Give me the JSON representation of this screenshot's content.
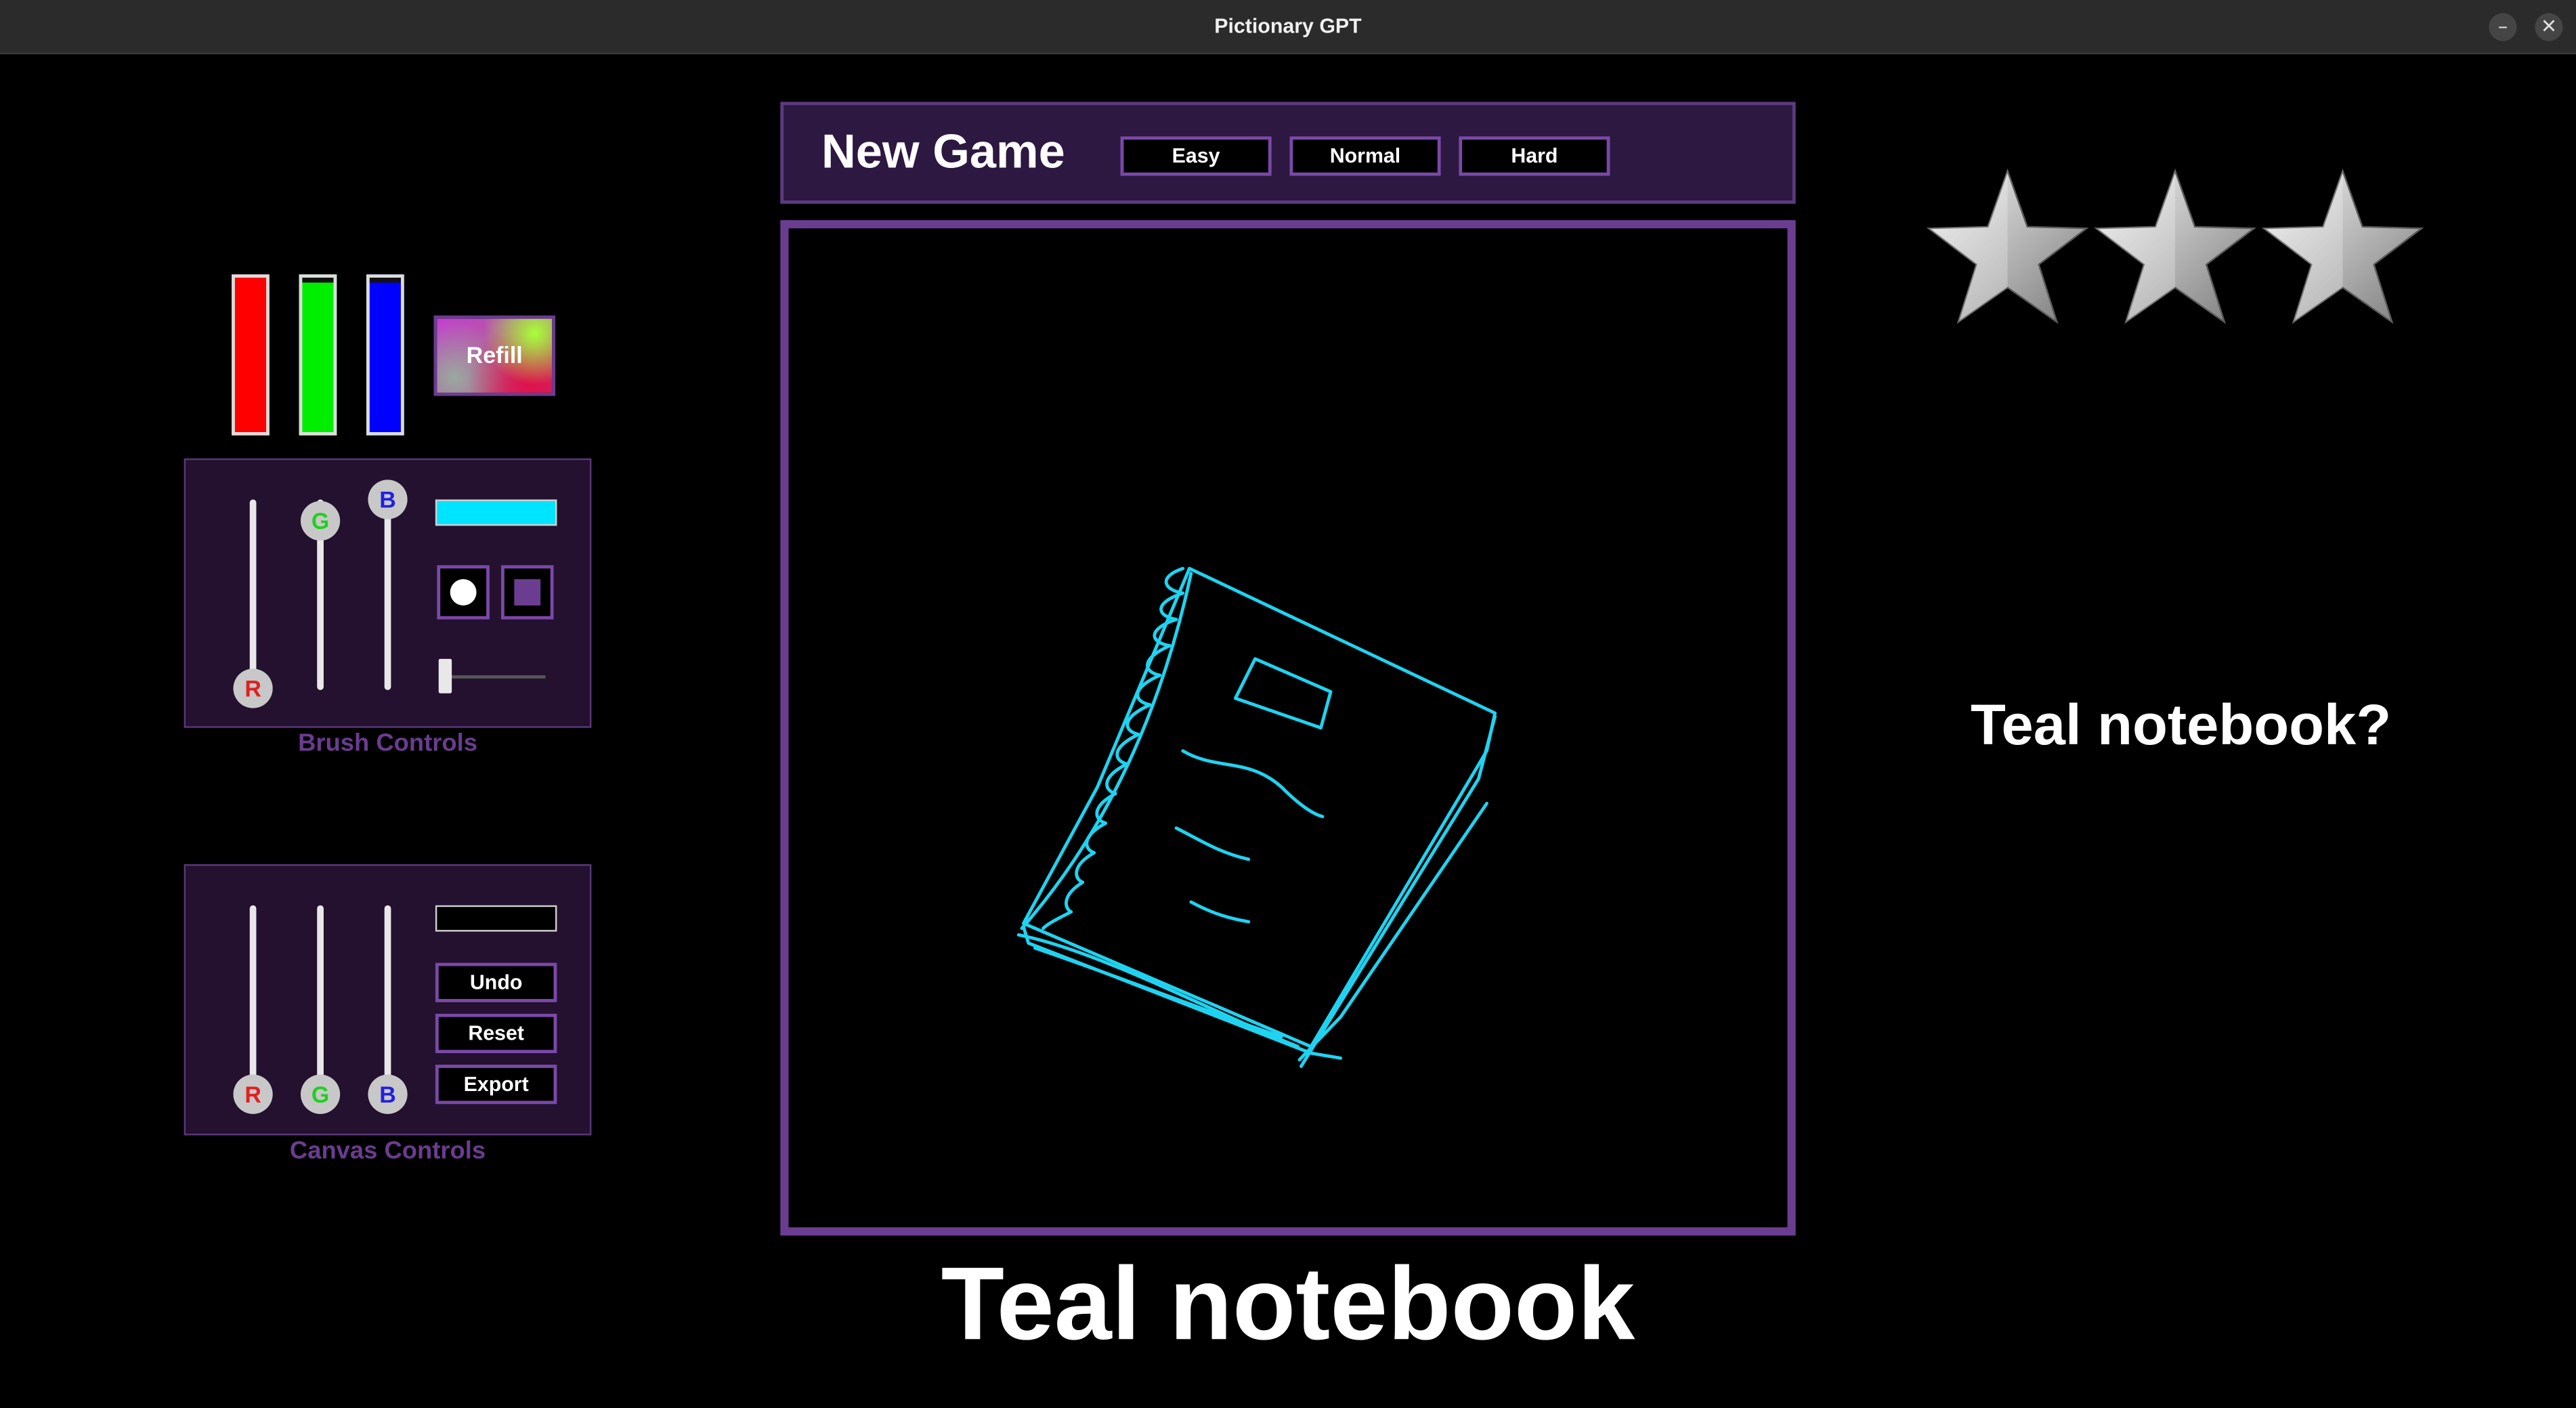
{
  "window": {
    "title": "Pictionary GPT",
    "minimize_glyph": "–",
    "close_glyph": "✕"
  },
  "header": {
    "title": "New Game",
    "difficulty": [
      {
        "label": "Easy"
      },
      {
        "label": "Normal"
      },
      {
        "label": "Hard"
      }
    ]
  },
  "refill": {
    "label": "Refill"
  },
  "ink_levels": {
    "red": 1.0,
    "green": 0.96,
    "blue": 0.96
  },
  "brush_controls": {
    "label": "Brush Controls",
    "sliders": {
      "r": "R",
      "g": "G",
      "b": "B"
    },
    "slider_values": {
      "r": 0,
      "g": 0.88,
      "b": 1.0
    },
    "color": "#00e5ff",
    "size_value": 0.05
  },
  "canvas_controls": {
    "label": "Canvas Controls",
    "sliders": {
      "r": "R",
      "g": "G",
      "b": "B"
    },
    "slider_values": {
      "r": 0,
      "g": 0,
      "b": 0
    },
    "color": "#000000",
    "buttons": {
      "undo": "Undo",
      "reset": "Reset",
      "export": "Export"
    }
  },
  "stars": {
    "earned": 3,
    "total": 3
  },
  "drawing": {
    "stroke_color": "#1fd3f0",
    "subject": "notebook-sketch"
  },
  "answer": "Teal notebook",
  "guess": "Teal notebook?",
  "colors": {
    "accent": "#6b3d91",
    "panel": "#23112f",
    "header": "#2c1840"
  }
}
